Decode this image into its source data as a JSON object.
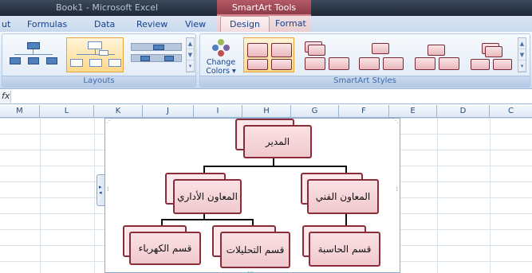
{
  "window": {
    "title": "Book1 - Microsoft Excel",
    "context_tools": "SmartArt Tools"
  },
  "tabs": [
    {
      "label": "ut"
    },
    {
      "label": "Formulas"
    },
    {
      "label": "Data"
    },
    {
      "label": "Review"
    },
    {
      "label": "View"
    },
    {
      "label": "Design"
    },
    {
      "label": "Format"
    }
  ],
  "ribbon": {
    "layouts_label": "Layouts",
    "change_colors_label_1": "Change",
    "change_colors_label_2": "Colors ▾",
    "styles_label": "SmartArt Styles"
  },
  "formula_bar": {
    "fx": "fx"
  },
  "columns": [
    "M",
    "L",
    "K",
    "J",
    "I",
    "H",
    "G",
    "F",
    "E",
    "D",
    "C"
  ],
  "smartart": {
    "root": "المدير",
    "left_assistant": "المعاون الأداري",
    "right_assistant": "المعاون الفني",
    "leaf_electric": "قسم الكهرباء",
    "leaf_analysis": "قسم التحليلات",
    "leaf_computer": "قسم الحاسبة"
  },
  "colors": {
    "accent_context": "#8a3a46",
    "node_border": "#8b2d38",
    "node_fill": "#f0c9ce"
  }
}
